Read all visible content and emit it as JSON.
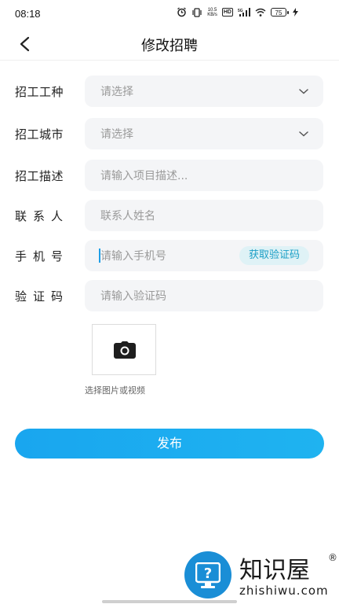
{
  "status": {
    "time": "08:18",
    "net_speed_value": "10.5",
    "net_speed_unit": "KB/s",
    "hd": "HD",
    "signal": "5G",
    "battery": "75"
  },
  "nav": {
    "title": "修改招聘"
  },
  "form": {
    "job_type": {
      "label": "招工工种",
      "placeholder": "请选择"
    },
    "city": {
      "label": "招工城市",
      "placeholder": "请选择"
    },
    "description": {
      "label": "招工描述",
      "placeholder": "请输入项目描述..."
    },
    "contact": {
      "label": "联系人",
      "placeholder": "联系人姓名"
    },
    "phone": {
      "label": "手机号",
      "placeholder": "请输入手机号",
      "code_button": "获取验证码"
    },
    "code": {
      "label": "验证码",
      "placeholder": "请输入验证码"
    }
  },
  "upload": {
    "caption": "选择图片或视频"
  },
  "publish_button": "发布",
  "watermark": {
    "name": "知识屋",
    "reg": "®",
    "url": "zhishiwu.com"
  },
  "colors": {
    "accent": "#1aa8ef",
    "field_bg": "#f4f5f7",
    "code_text": "#1b9fc6"
  }
}
